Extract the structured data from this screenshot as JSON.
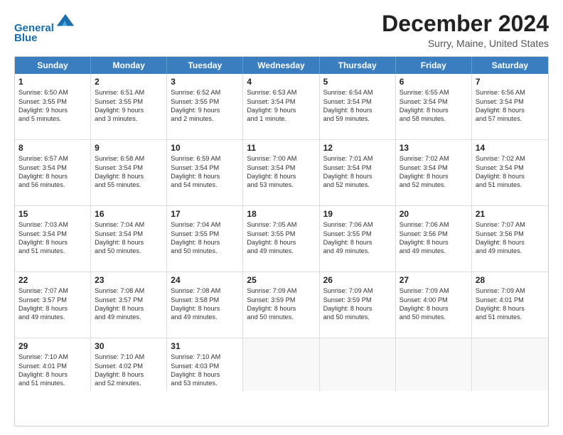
{
  "header": {
    "logo_line1": "General",
    "logo_line2": "Blue",
    "month_title": "December 2024",
    "location": "Surry, Maine, United States"
  },
  "weekdays": [
    "Sunday",
    "Monday",
    "Tuesday",
    "Wednesday",
    "Thursday",
    "Friday",
    "Saturday"
  ],
  "rows": [
    [
      {
        "day": "1",
        "lines": [
          "Sunrise: 6:50 AM",
          "Sunset: 3:55 PM",
          "Daylight: 9 hours",
          "and 5 minutes."
        ]
      },
      {
        "day": "2",
        "lines": [
          "Sunrise: 6:51 AM",
          "Sunset: 3:55 PM",
          "Daylight: 9 hours",
          "and 3 minutes."
        ]
      },
      {
        "day": "3",
        "lines": [
          "Sunrise: 6:52 AM",
          "Sunset: 3:55 PM",
          "Daylight: 9 hours",
          "and 2 minutes."
        ]
      },
      {
        "day": "4",
        "lines": [
          "Sunrise: 6:53 AM",
          "Sunset: 3:54 PM",
          "Daylight: 9 hours",
          "and 1 minute."
        ]
      },
      {
        "day": "5",
        "lines": [
          "Sunrise: 6:54 AM",
          "Sunset: 3:54 PM",
          "Daylight: 8 hours",
          "and 59 minutes."
        ]
      },
      {
        "day": "6",
        "lines": [
          "Sunrise: 6:55 AM",
          "Sunset: 3:54 PM",
          "Daylight: 8 hours",
          "and 58 minutes."
        ]
      },
      {
        "day": "7",
        "lines": [
          "Sunrise: 6:56 AM",
          "Sunset: 3:54 PM",
          "Daylight: 8 hours",
          "and 57 minutes."
        ]
      }
    ],
    [
      {
        "day": "8",
        "lines": [
          "Sunrise: 6:57 AM",
          "Sunset: 3:54 PM",
          "Daylight: 8 hours",
          "and 56 minutes."
        ]
      },
      {
        "day": "9",
        "lines": [
          "Sunrise: 6:58 AM",
          "Sunset: 3:54 PM",
          "Daylight: 8 hours",
          "and 55 minutes."
        ]
      },
      {
        "day": "10",
        "lines": [
          "Sunrise: 6:59 AM",
          "Sunset: 3:54 PM",
          "Daylight: 8 hours",
          "and 54 minutes."
        ]
      },
      {
        "day": "11",
        "lines": [
          "Sunrise: 7:00 AM",
          "Sunset: 3:54 PM",
          "Daylight: 8 hours",
          "and 53 minutes."
        ]
      },
      {
        "day": "12",
        "lines": [
          "Sunrise: 7:01 AM",
          "Sunset: 3:54 PM",
          "Daylight: 8 hours",
          "and 52 minutes."
        ]
      },
      {
        "day": "13",
        "lines": [
          "Sunrise: 7:02 AM",
          "Sunset: 3:54 PM",
          "Daylight: 8 hours",
          "and 52 minutes."
        ]
      },
      {
        "day": "14",
        "lines": [
          "Sunrise: 7:02 AM",
          "Sunset: 3:54 PM",
          "Daylight: 8 hours",
          "and 51 minutes."
        ]
      }
    ],
    [
      {
        "day": "15",
        "lines": [
          "Sunrise: 7:03 AM",
          "Sunset: 3:54 PM",
          "Daylight: 8 hours",
          "and 51 minutes."
        ]
      },
      {
        "day": "16",
        "lines": [
          "Sunrise: 7:04 AM",
          "Sunset: 3:54 PM",
          "Daylight: 8 hours",
          "and 50 minutes."
        ]
      },
      {
        "day": "17",
        "lines": [
          "Sunrise: 7:04 AM",
          "Sunset: 3:55 PM",
          "Daylight: 8 hours",
          "and 50 minutes."
        ]
      },
      {
        "day": "18",
        "lines": [
          "Sunrise: 7:05 AM",
          "Sunset: 3:55 PM",
          "Daylight: 8 hours",
          "and 49 minutes."
        ]
      },
      {
        "day": "19",
        "lines": [
          "Sunrise: 7:06 AM",
          "Sunset: 3:55 PM",
          "Daylight: 8 hours",
          "and 49 minutes."
        ]
      },
      {
        "day": "20",
        "lines": [
          "Sunrise: 7:06 AM",
          "Sunset: 3:56 PM",
          "Daylight: 8 hours",
          "and 49 minutes."
        ]
      },
      {
        "day": "21",
        "lines": [
          "Sunrise: 7:07 AM",
          "Sunset: 3:56 PM",
          "Daylight: 8 hours",
          "and 49 minutes."
        ]
      }
    ],
    [
      {
        "day": "22",
        "lines": [
          "Sunrise: 7:07 AM",
          "Sunset: 3:57 PM",
          "Daylight: 8 hours",
          "and 49 minutes."
        ]
      },
      {
        "day": "23",
        "lines": [
          "Sunrise: 7:08 AM",
          "Sunset: 3:57 PM",
          "Daylight: 8 hours",
          "and 49 minutes."
        ]
      },
      {
        "day": "24",
        "lines": [
          "Sunrise: 7:08 AM",
          "Sunset: 3:58 PM",
          "Daylight: 8 hours",
          "and 49 minutes."
        ]
      },
      {
        "day": "25",
        "lines": [
          "Sunrise: 7:09 AM",
          "Sunset: 3:59 PM",
          "Daylight: 8 hours",
          "and 50 minutes."
        ]
      },
      {
        "day": "26",
        "lines": [
          "Sunrise: 7:09 AM",
          "Sunset: 3:59 PM",
          "Daylight: 8 hours",
          "and 50 minutes."
        ]
      },
      {
        "day": "27",
        "lines": [
          "Sunrise: 7:09 AM",
          "Sunset: 4:00 PM",
          "Daylight: 8 hours",
          "and 50 minutes."
        ]
      },
      {
        "day": "28",
        "lines": [
          "Sunrise: 7:09 AM",
          "Sunset: 4:01 PM",
          "Daylight: 8 hours",
          "and 51 minutes."
        ]
      }
    ],
    [
      {
        "day": "29",
        "lines": [
          "Sunrise: 7:10 AM",
          "Sunset: 4:01 PM",
          "Daylight: 8 hours",
          "and 51 minutes."
        ]
      },
      {
        "day": "30",
        "lines": [
          "Sunrise: 7:10 AM",
          "Sunset: 4:02 PM",
          "Daylight: 8 hours",
          "and 52 minutes."
        ]
      },
      {
        "day": "31",
        "lines": [
          "Sunrise: 7:10 AM",
          "Sunset: 4:03 PM",
          "Daylight: 8 hours",
          "and 53 minutes."
        ]
      },
      {
        "day": "",
        "lines": []
      },
      {
        "day": "",
        "lines": []
      },
      {
        "day": "",
        "lines": []
      },
      {
        "day": "",
        "lines": []
      }
    ]
  ]
}
